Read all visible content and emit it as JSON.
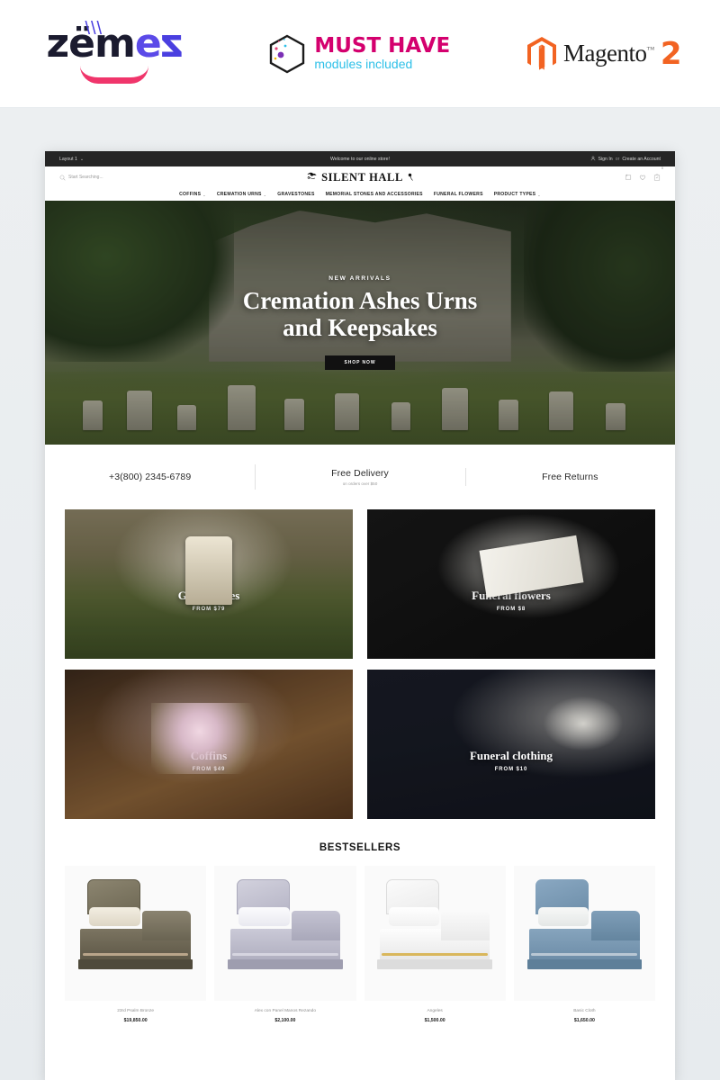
{
  "brandbar": {
    "zemez": {
      "text_part1": "z",
      "text_em": "ëm",
      "text_e": "e",
      "text_z2": "z",
      "full": "zemez"
    },
    "musthave": {
      "title": "MUST HAVE",
      "subtitle": "modules included"
    },
    "magento": {
      "word": "Magento",
      "tm": "™",
      "version": "2"
    }
  },
  "site": {
    "topbar": {
      "layout_label": "Layout 1",
      "caret": "⌄",
      "welcome": "Welcome to our online store!",
      "sign_in": "Sign In",
      "separator": "or",
      "create_account": "Create an Account",
      "user_icon": "user-icon"
    },
    "header": {
      "search_placeholder": "Start Searching...",
      "search_icon": "search-icon",
      "logo_text": "SILENT HALL",
      "logo_left_icon": "bird-ornament-icon",
      "logo_right_icon": "flower-ornament-icon",
      "icons": [
        {
          "name": "compare-icon",
          "glyph": "compare"
        },
        {
          "name": "wishlist-heart-icon",
          "glyph": "heart"
        },
        {
          "name": "cart-icon",
          "glyph": "bag",
          "badge": "0"
        }
      ]
    },
    "nav": [
      {
        "label": "COFFINS",
        "has_dropdown": true
      },
      {
        "label": "CREMATION URNS",
        "has_dropdown": true
      },
      {
        "label": "GRAVESTONES",
        "has_dropdown": false
      },
      {
        "label": "MEMORIAL STONES AND ACCESSORIES",
        "has_dropdown": false
      },
      {
        "label": "FUNERAL FLOWERS",
        "has_dropdown": false
      },
      {
        "label": "PRODUCT TYPES",
        "has_dropdown": true
      }
    ],
    "hero": {
      "kicker": "NEW ARRIVALS",
      "title_line1": "Cremation Ashes Urns",
      "title_line2": "and Keepsakes",
      "button_label": "SHOP NOW"
    },
    "services": [
      {
        "title": "+3(800) 2345-6789",
        "subtitle": ""
      },
      {
        "title": "Free Delivery",
        "subtitle": "on orders over $50"
      },
      {
        "title": "Free Returns",
        "subtitle": ""
      }
    ],
    "tiles": [
      {
        "name": "Gravestones",
        "price_from": "FROM $79",
        "image": "gravestones-photo"
      },
      {
        "name": "Funeral flowers",
        "price_from": "FROM $8",
        "image": "funeral-flowers-photo"
      },
      {
        "name": "Coffins",
        "price_from": "FROM $49",
        "image": "coffins-photo"
      },
      {
        "name": "Funeral clothing",
        "price_from": "FROM $10",
        "image": "funeral-clothing-photo"
      }
    ],
    "bestsellers": {
      "heading": "BESTSELLERS",
      "products": [
        {
          "name": "23rd Psalm Bronze",
          "price": "$19,850.00",
          "colors": {
            "body": "#6f6a57",
            "lid": "#7d7862",
            "interior": "#efe9dd",
            "accent": "#b9a58a"
          }
        },
        {
          "name": "Alex con Panel Manos Rezando",
          "price": "$2,100.00",
          "colors": {
            "body": "#c9c8d6",
            "lid": "#b9b8c9",
            "interior": "#f7f7fa",
            "accent": "#d6d5e0"
          }
        },
        {
          "name": "Angeles",
          "price": "$1,500.00",
          "colors": {
            "body": "#f2f2f2",
            "lid": "#e8e8e8",
            "interior": "#fdfdfd",
            "accent": "#d9b75c"
          }
        },
        {
          "name": "Basic Cloth",
          "price": "$1,650.00",
          "colors": {
            "body": "#7a9ab5",
            "lid": "#6f90ac",
            "interior": "#f3f4f3",
            "accent": "#9fb6c9"
          }
        }
      ]
    }
  },
  "colors": {
    "topbar_bg": "#252525",
    "accent_pink": "#f0356b",
    "accent_violet": "#4a3fe0",
    "magento_orange": "#f26322",
    "musthave_pink": "#d4006e",
    "musthave_cyan": "#2ec0e8"
  }
}
